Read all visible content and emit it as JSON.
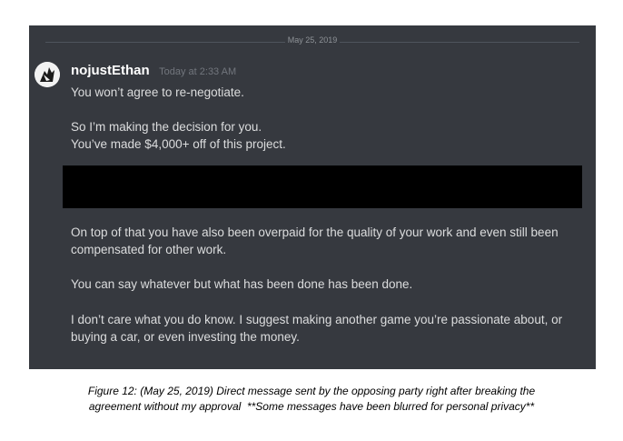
{
  "chat": {
    "date_divider": "May 25, 2019",
    "username": "nojustEthan",
    "timestamp": "Today at 2:33 AM",
    "messages": [
      "You won’t agree to re-negotiate.",
      "So I’m making the decision for you.",
      "You’ve made $4,000+ off of this project.",
      "On top of that you have also been overpaid for the quality of your work and even still been compensated for other work.",
      "You can say whatever but what has been done has been done.",
      "I don’t care what you do know. I suggest making another game you’re passionate about, or buying a car, or even investing the money."
    ]
  },
  "caption": {
    "line1": "Figure 12: (May 25, 2019) Direct message sent by the opposing party right after breaking the",
    "line2": "agreement without my approval  **Some messages have been blurred for personal privacy**"
  },
  "colors": {
    "chat_background": "#36393f",
    "redaction": "#000000"
  }
}
